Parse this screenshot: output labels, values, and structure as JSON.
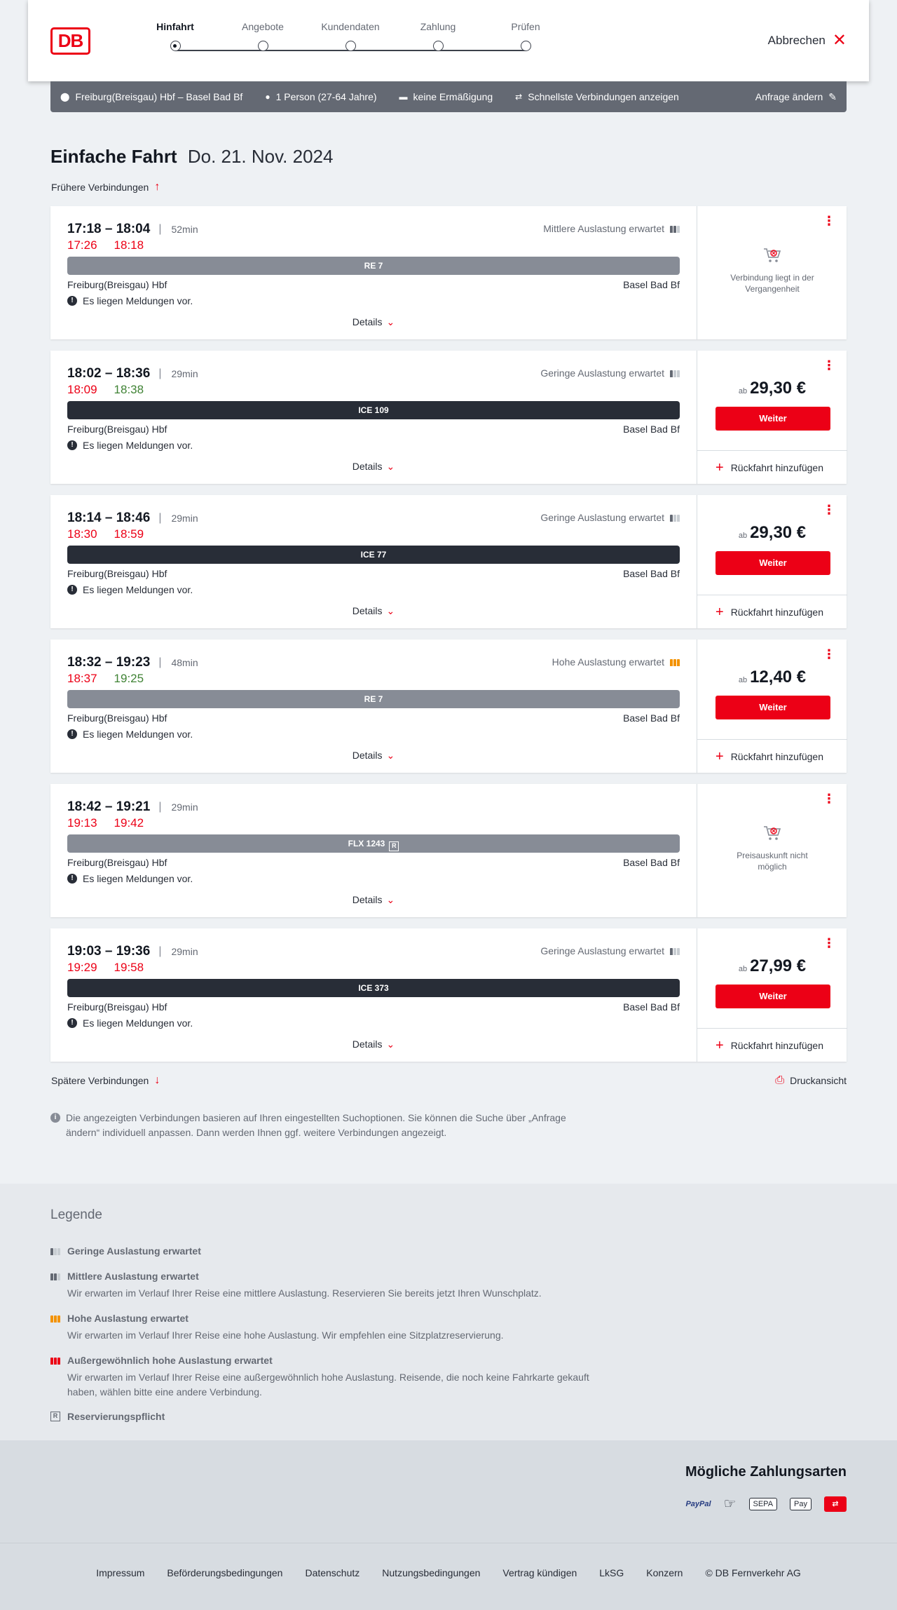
{
  "header": {
    "logo": "DB",
    "steps": [
      "Hinfahrt",
      "Angebote",
      "Kundendaten",
      "Zahlung",
      "Prüfen"
    ],
    "active_step": 0,
    "cancel": "Abbrechen"
  },
  "search": {
    "route": "Freiburg(Breisgau) Hbf – Basel Bad Bf",
    "passengers": "1 Person (27-64 Jahre)",
    "discount": "keine Ermäßigung",
    "fastest": "Schnellste Verbindungen anzeigen",
    "change": "Anfrage ändern"
  },
  "title": {
    "trip": "Einfache Fahrt",
    "date": "Do. 21. Nov. 2024"
  },
  "earlier": "Frühere Verbindungen",
  "later": "Spätere Verbindungen",
  "print": "Druckansicht",
  "connections": [
    {
      "time": "17:18 – 18:04",
      "duration": "52min",
      "rt_dep": "17:26",
      "rt_dep_status": "late",
      "rt_arr": "18:18",
      "rt_arr_status": "late",
      "load": "Mittlere Auslastung erwartet",
      "load_level": 2,
      "train": "RE 7",
      "train_style": "regional",
      "from": "Freiburg(Breisgau) Hbf",
      "to": "Basel Bad Bf",
      "message": "Es liegen Meldungen vor.",
      "details": "Details",
      "unavailable": "Verbindung liegt in der Vergangenheit"
    },
    {
      "time": "18:02 – 18:36",
      "duration": "29min",
      "rt_dep": "18:09",
      "rt_dep_status": "late",
      "rt_arr": "18:38",
      "rt_arr_status": "ontime",
      "load": "Geringe Auslastung erwartet",
      "load_level": 1,
      "train": "ICE 109",
      "train_style": "ice",
      "from": "Freiburg(Breisgau) Hbf",
      "to": "Basel Bad Bf",
      "message": "Es liegen Meldungen vor.",
      "details": "Details",
      "price_prefix": "ab",
      "price": "29,30 €",
      "button": "Weiter",
      "return": "Rückfahrt hinzufügen"
    },
    {
      "time": "18:14 – 18:46",
      "duration": "29min",
      "rt_dep": "18:30",
      "rt_dep_status": "late",
      "rt_arr": "18:59",
      "rt_arr_status": "late",
      "load": "Geringe Auslastung erwartet",
      "load_level": 1,
      "train": "ICE 77",
      "train_style": "ice",
      "from": "Freiburg(Breisgau) Hbf",
      "to": "Basel Bad Bf",
      "message": "Es liegen Meldungen vor.",
      "details": "Details",
      "price_prefix": "ab",
      "price": "29,30 €",
      "button": "Weiter",
      "return": "Rückfahrt hinzufügen"
    },
    {
      "time": "18:32 – 19:23",
      "duration": "48min",
      "rt_dep": "18:37",
      "rt_dep_status": "late",
      "rt_arr": "19:25",
      "rt_arr_status": "ontime",
      "load": "Hohe Auslastung erwartet",
      "load_level": 3,
      "train": "RE 7",
      "train_style": "regional",
      "from": "Freiburg(Breisgau) Hbf",
      "to": "Basel Bad Bf",
      "message": "Es liegen Meldungen vor.",
      "details": "Details",
      "price_prefix": "ab",
      "price": "12,40 €",
      "button": "Weiter",
      "return": "Rückfahrt hinzufügen"
    },
    {
      "time": "18:42 – 19:21",
      "duration": "29min",
      "rt_dep": "19:13",
      "rt_dep_status": "late",
      "rt_arr": "19:42",
      "rt_arr_status": "late",
      "load": "",
      "load_level": 0,
      "train": "FLX 1243",
      "train_res": "R",
      "train_style": "regional",
      "from": "Freiburg(Breisgau) Hbf",
      "to": "Basel Bad Bf",
      "message": "Es liegen Meldungen vor.",
      "details": "Details",
      "unavailable": "Preisauskunft nicht möglich"
    },
    {
      "time": "19:03 – 19:36",
      "duration": "29min",
      "rt_dep": "19:29",
      "rt_dep_status": "late",
      "rt_arr": "19:58",
      "rt_arr_status": "late",
      "load": "Geringe Auslastung erwartet",
      "load_level": 1,
      "train": "ICE 373",
      "train_style": "ice",
      "from": "Freiburg(Breisgau) Hbf",
      "to": "Basel Bad Bf",
      "message": "Es liegen Meldungen vor.",
      "details": "Details",
      "price_prefix": "ab",
      "price": "27,99 €",
      "button": "Weiter",
      "return": "Rückfahrt hinzufügen"
    }
  ],
  "info": "Die angezeigten Verbindungen basieren auf Ihren eingestellten Suchoptionen. Sie können die Suche über „Anfrage ändern“ individuell anpassen. Dann werden Ihnen ggf. weitere Verbindungen angezeigt.",
  "legend": {
    "title": "Legende",
    "items": [
      {
        "title": "Geringe Auslastung erwartet",
        "desc": ""
      },
      {
        "title": "Mittlere Auslastung erwartet",
        "desc": "Wir erwarten im Verlauf Ihrer Reise eine mittlere Auslastung. Reservieren Sie bereits jetzt Ihren Wunschplatz."
      },
      {
        "title": "Hohe Auslastung erwartet",
        "desc": "Wir erwarten im Verlauf Ihrer Reise eine hohe Auslastung. Wir empfehlen eine Sitzplatzreservierung."
      },
      {
        "title": "Außergewöhnlich hohe Auslastung erwartet",
        "desc": "Wir erwarten im Verlauf Ihrer Reise eine außergewöhnlich hohe Auslastung. Reisende, die noch keine Fahrkarte gekauft haben, wählen bitte eine andere Verbindung."
      },
      {
        "title": "Reservierungspflicht",
        "desc": ""
      }
    ],
    "res_symbol": "R"
  },
  "payment": {
    "title": "Mögliche Zahlungsarten",
    "paypal": "PayPal",
    "sepa": "SEPA",
    "applepay": "Pay"
  },
  "footer": [
    "Impressum",
    "Beförderungsbedingungen",
    "Datenschutz",
    "Nutzungsbedingungen",
    "Vertrag kündigen",
    "LkSG",
    "Konzern",
    "© DB Fernverkehr AG"
  ]
}
